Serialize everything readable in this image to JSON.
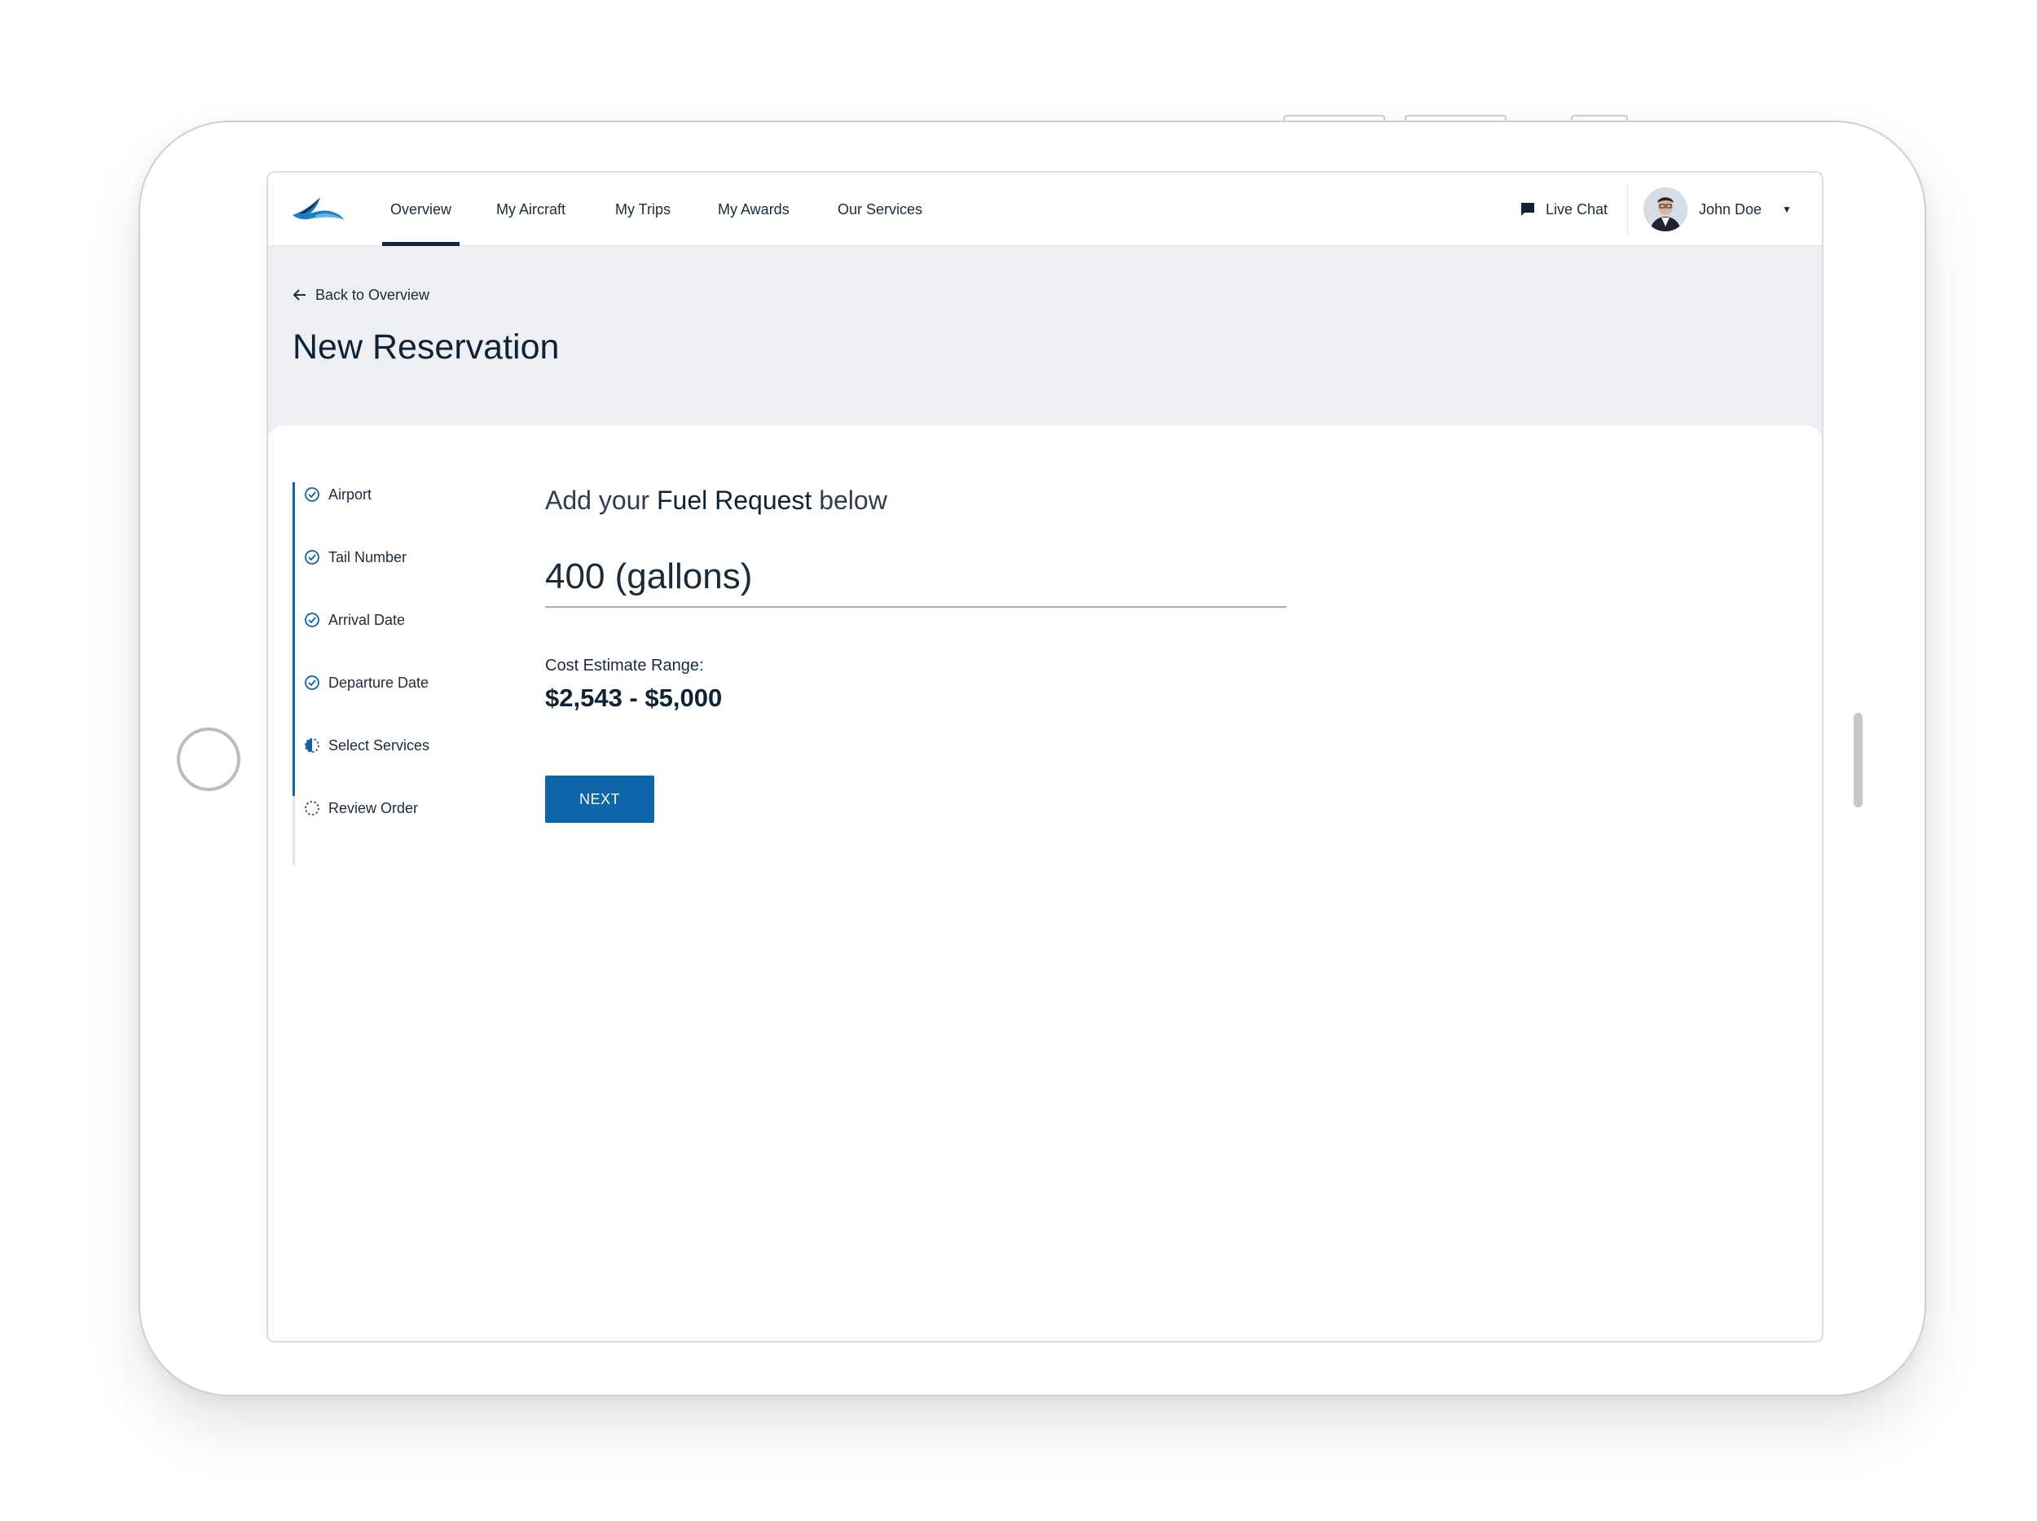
{
  "nav": {
    "items": [
      {
        "label": "Overview",
        "active": true
      },
      {
        "label": "My Aircraft",
        "active": false
      },
      {
        "label": "My Trips",
        "active": false
      },
      {
        "label": "My Awards",
        "active": false
      },
      {
        "label": "Our Services",
        "active": false
      }
    ],
    "live_chat": "Live Chat",
    "user_name": "John Doe",
    "logo_icon": "bird-wing-logo",
    "chat_icon": "chat-bubble-icon",
    "caret_icon": "caret-down-icon"
  },
  "header": {
    "back_link": "Back to Overview",
    "back_icon": "arrow-left-icon",
    "title": "New Reservation"
  },
  "steps": [
    {
      "label": "Airport",
      "status": "complete"
    },
    {
      "label": "Tail Number",
      "status": "complete"
    },
    {
      "label": "Arrival Date",
      "status": "complete"
    },
    {
      "label": "Departure Date",
      "status": "complete"
    },
    {
      "label": "Select Services",
      "status": "in-progress"
    },
    {
      "label": "Review Order",
      "status": "pending"
    }
  ],
  "form": {
    "prompt_prefix": "Add your ",
    "prompt_emphasis": "Fuel Request",
    "prompt_suffix": " below",
    "fuel_value": "400 (gallons)",
    "cost_label": "Cost Estimate Range:",
    "cost_range": "$2,543 - $5,000",
    "next_label": "NEXT"
  },
  "colors": {
    "primary": "#0e65a8",
    "navy": "#0f2a44",
    "header_band": "#edeff2",
    "text": "#1c2b3a"
  }
}
